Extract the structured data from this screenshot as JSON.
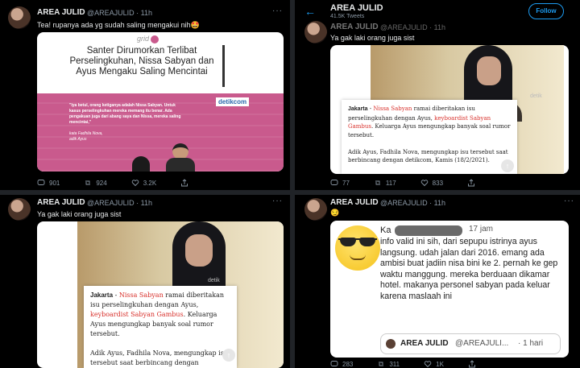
{
  "colors": {
    "accent": "#1d9bf0",
    "bg": "#000000",
    "link_red": "#d8302b",
    "detik_blue": "#2b67ad",
    "pink": "#c95a8d"
  },
  "header": {
    "title": "AREA JULID",
    "subtitle": "41.5K Tweets",
    "follow": "Follow"
  },
  "t1": {
    "name": "AREA JULID",
    "handle": "@AREAJULID · 11h",
    "text": "Tea! rupanya ada yg sudah saling mengakui nih🤩",
    "brand": "grid",
    "headline": "Santer Dirumorkan Terlibat Perselingkuhan, Nissa Sabyan dan Ayus Mengaku Saling Mencintai",
    "quote": "\"Iya betul, orang ketiganya adalah Nissa Sabyan. Untuk kasus perselingkuhan mereka memang itu benar. Ada pengakuan juga dari abang saya dan Nissa, mereka saling mencintai,\"",
    "quote_by1": "kata Fadhila Nova,",
    "quote_by2": "adik Ayus",
    "detik": "detikcom",
    "replies": "901",
    "retweets": "924",
    "likes": "3.2K"
  },
  "t2": {
    "name": "AREA JULID",
    "handle": "@AREAJULID · 11h",
    "text": "Ya gak laki orang juga sist",
    "replies": "77",
    "retweets": "117",
    "likes": "833"
  },
  "t3": {
    "name": "AREA JULID",
    "handle": "@AREAJULID · 11h",
    "text": "Ya gak laki orang juga sist",
    "replies": "",
    "retweets": "",
    "likes": ""
  },
  "article": {
    "city": "Jakarta",
    "dash": " - ",
    "link1": "Nissa Sabyan",
    "p1a": " ramai diberitakan isu perselingkuhan dengan Ayus, ",
    "link2": "keyboardist Sabyan Gambus",
    "p1b": ". Keluarga Ayus mengungkap banyak soal rumor tersebut.",
    "p2": "Adik Ayus, Fadhila Nova, mengungkap isu tersebut saat berbincang dengan detikcom, Kamis (18/2/2021).",
    "watermark": "detik"
  },
  "t4": {
    "name": "AREA JULID",
    "handle": "@AREAJULID · 11h",
    "emoji": "😏",
    "reply_name": "Ka",
    "reply_time": "17 jam",
    "reply_text": "info valid ini sih, dari sepupu istrinya ayus langsung. udah jalan dari 2016. emang ada ambisi buat jadiin nisa bini ke 2. pernah ke gep waktu manggung. mereka berduaan dikamar hotel. makanya personel sabyan pada keluar karena maslaah ini",
    "quoted_name": "AREA JULID",
    "quoted_handle": "@AREAJULI...",
    "quoted_time": "· 1 hari",
    "replies": "283",
    "retweets": "311",
    "likes": "1K"
  }
}
